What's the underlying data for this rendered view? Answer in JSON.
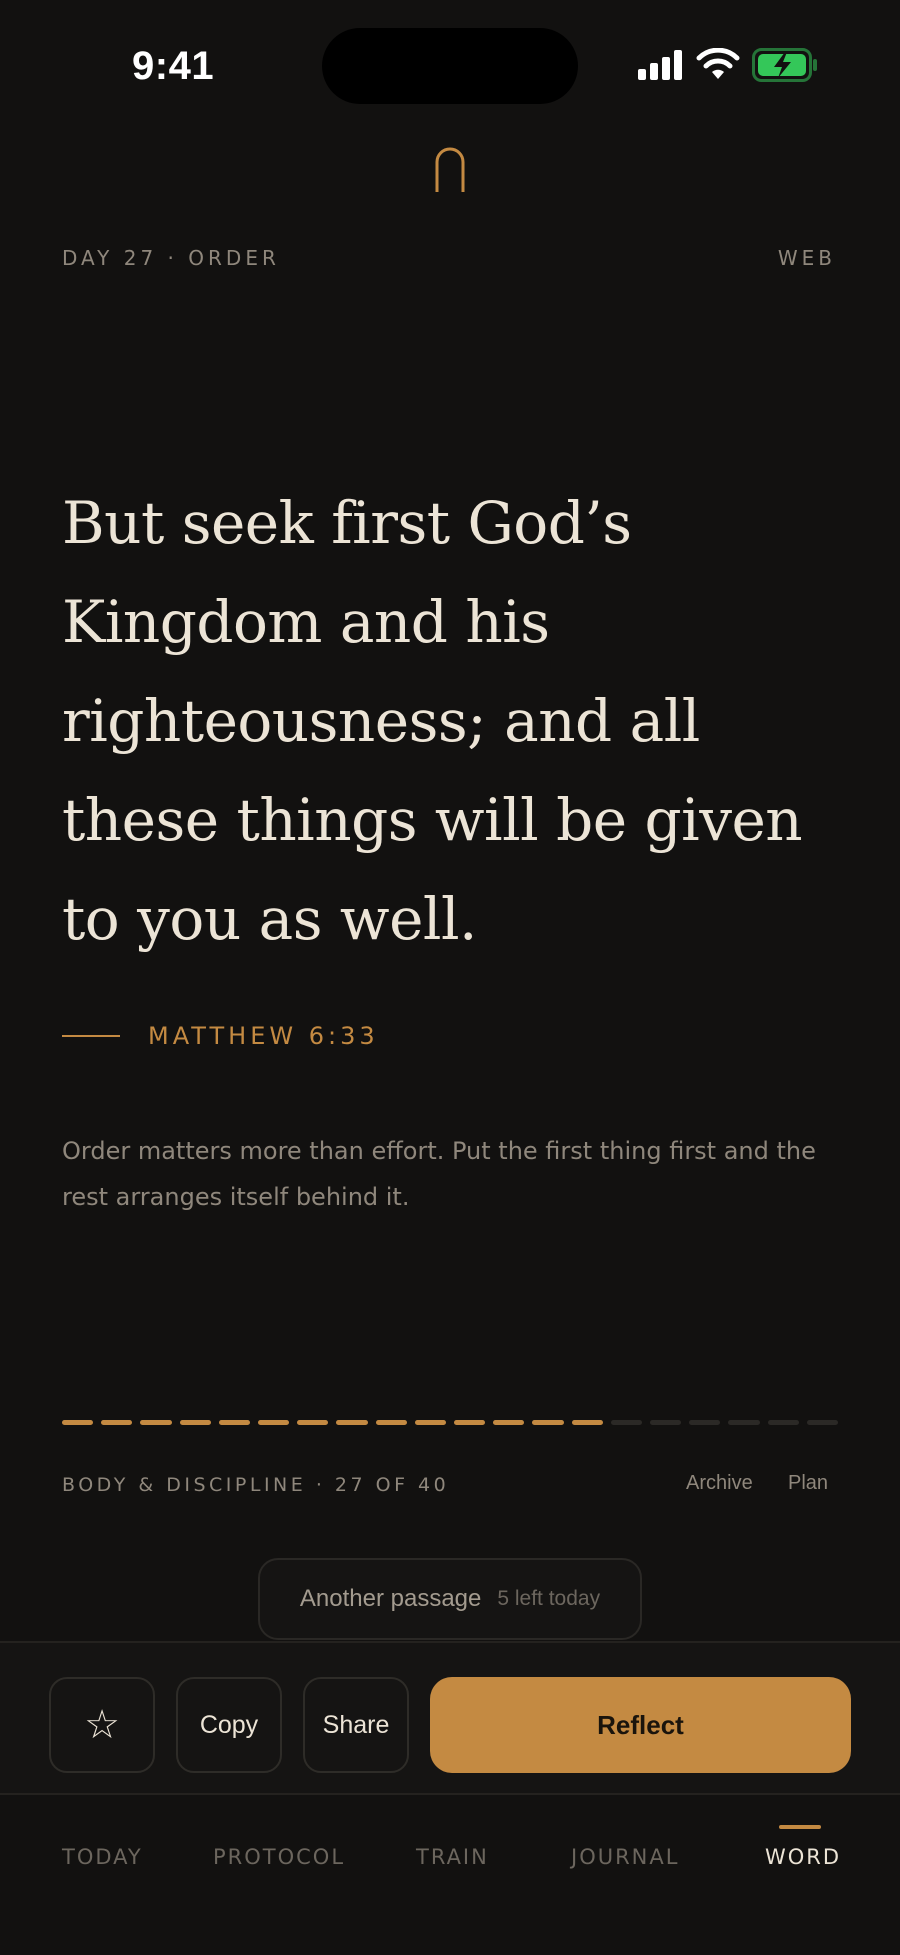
{
  "status_bar": {
    "time": "9:41",
    "icons": [
      "signal-icon",
      "wifi-icon",
      "battery-charging-icon"
    ],
    "battery_color": "#34c759"
  },
  "header": {
    "logo_icon": "arch-logo-icon",
    "day_label": "DAY 27 · ORDER",
    "translation": "WEB"
  },
  "verse": {
    "text": "But seek first God’s Kingdom and his righteousness; and all these things will be given to you as well.",
    "reference": "MATTHEW 6:33"
  },
  "reflection": "Order matters more than effort. Put the first thing first and the rest arranges itself behind it.",
  "plan": {
    "label": "BODY & DISCIPLINE · 27 OF 40",
    "progress_fraction": 0.675,
    "segments_total": 20,
    "segments_done": 14,
    "archive_label": "Archive",
    "plan_label": "Plan"
  },
  "another_passage": {
    "label": "Another passage",
    "count": "5 left today"
  },
  "actions": {
    "favorite_icon": "star-icon",
    "copy_label": "Copy",
    "share_label": "Share",
    "reflect_label": "Reflect"
  },
  "tabs": [
    {
      "label": "TODAY",
      "active": false
    },
    {
      "label": "PROTOCOL",
      "active": false
    },
    {
      "label": "TRAIN",
      "active": false
    },
    {
      "label": "JOURNAL",
      "active": false
    },
    {
      "label": "WORD",
      "active": true
    }
  ],
  "colors": {
    "accent": "#c48a42",
    "background": "#121110",
    "text": "#ece4d6",
    "muted": "#8f877c"
  }
}
